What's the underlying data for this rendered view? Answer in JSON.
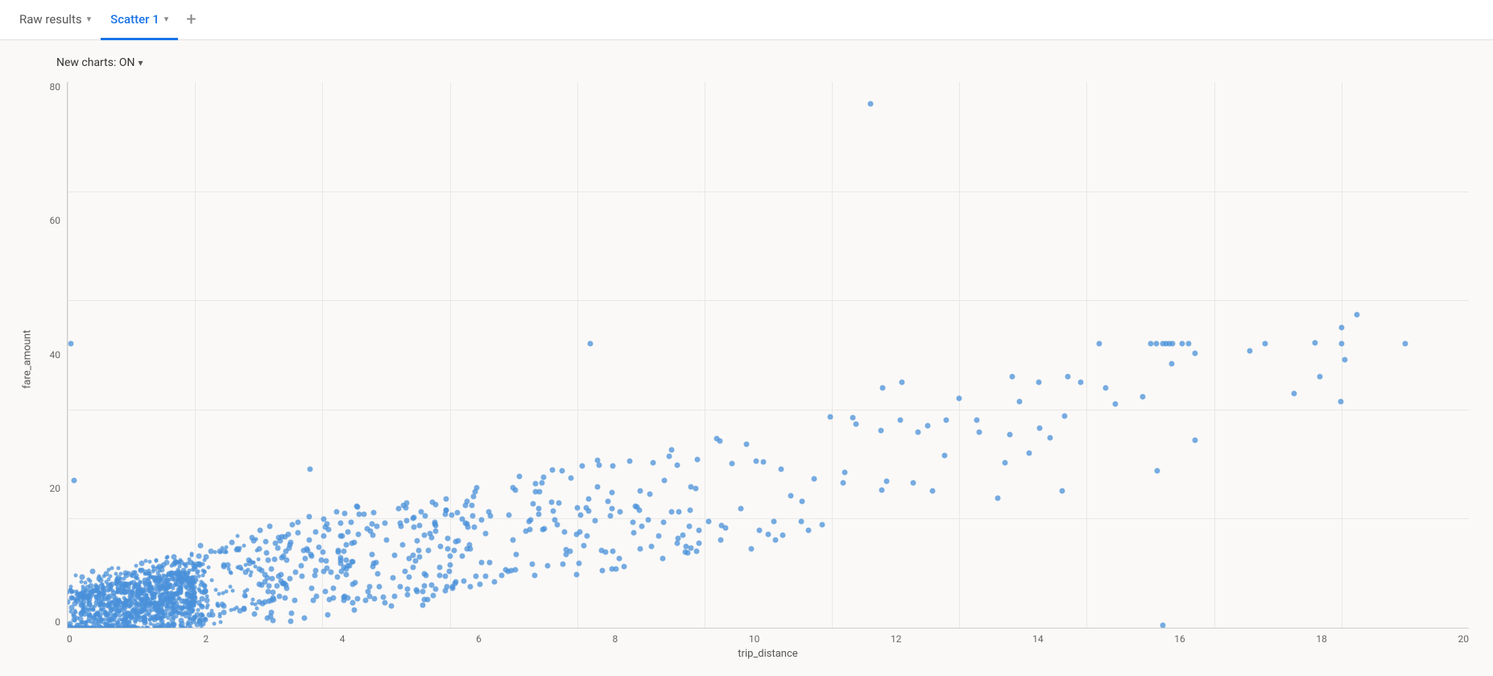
{
  "tabs": [
    {
      "id": "raw-results",
      "label": "Raw results",
      "active": false,
      "hasChevron": true
    },
    {
      "id": "scatter-1",
      "label": "Scatter 1",
      "active": true,
      "hasChevron": true
    }
  ],
  "tab_add_label": "+",
  "controls": {
    "new_charts_label": "New charts: ON",
    "chevron": "▾"
  },
  "chart": {
    "y_axis_label": "fare_amount",
    "x_axis_label": "trip_distance",
    "y_ticks": [
      "0",
      "20",
      "40",
      "60",
      "80"
    ],
    "x_ticks": [
      "0",
      "2",
      "4",
      "6",
      "8",
      "10",
      "12",
      "14",
      "16",
      "18",
      "20"
    ],
    "accent_color": "#4a90d9"
  }
}
